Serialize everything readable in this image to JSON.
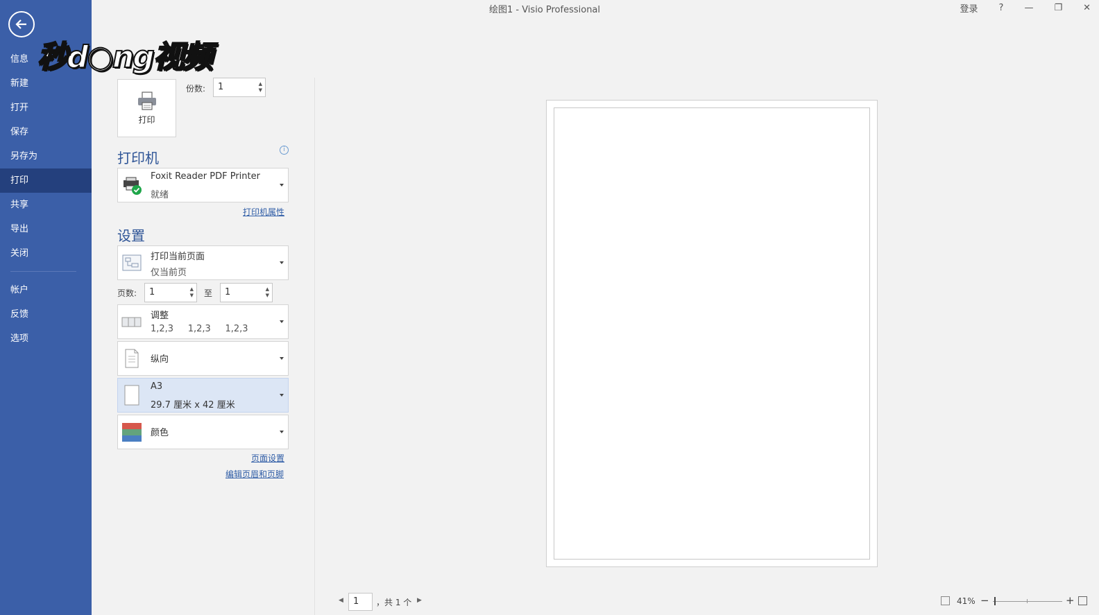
{
  "window": {
    "title": "绘图1  -  Visio Professional",
    "login": "登录",
    "help": "?",
    "minimize": "—",
    "restore": "❐",
    "close": "✕"
  },
  "watermark": "秒d○ng视频",
  "sidebar": {
    "items": [
      {
        "label": "信息"
      },
      {
        "label": "新建"
      },
      {
        "label": "打开"
      },
      {
        "label": "保存"
      },
      {
        "label": "另存为"
      },
      {
        "label": "打印"
      },
      {
        "label": "共享"
      },
      {
        "label": "导出"
      },
      {
        "label": "关闭"
      }
    ],
    "items2": [
      {
        "label": "帐户"
      },
      {
        "label": "反馈"
      },
      {
        "label": "选项"
      }
    ]
  },
  "print": {
    "button_label": "打印",
    "copies_label": "份数:",
    "copies_value": "1"
  },
  "printer": {
    "section_title": "打印机",
    "name": "Foxit Reader PDF Printer",
    "status": "就绪",
    "properties_link": "打印机属性"
  },
  "settings": {
    "section_title": "设置",
    "range": {
      "title": "打印当前页面",
      "subtitle": "仅当前页"
    },
    "pages_label": "页数:",
    "pages_from": "1",
    "to_label": "至",
    "pages_to": "1",
    "collate": {
      "title": "调整",
      "subtitle": "1,2,3     1,2,3     1,2,3"
    },
    "orientation": {
      "title": "纵向"
    },
    "paper": {
      "title": "A3",
      "subtitle": "29.7 厘米 x 42 厘米"
    },
    "color": {
      "title": "颜色"
    },
    "page_setup_link": "页面设置",
    "header_footer_link": "编辑页眉和页脚"
  },
  "preview": {
    "page_input": "1",
    "page_total": "，共 1 个",
    "zoom_percent": "41%",
    "zoom_level": 0.41
  }
}
